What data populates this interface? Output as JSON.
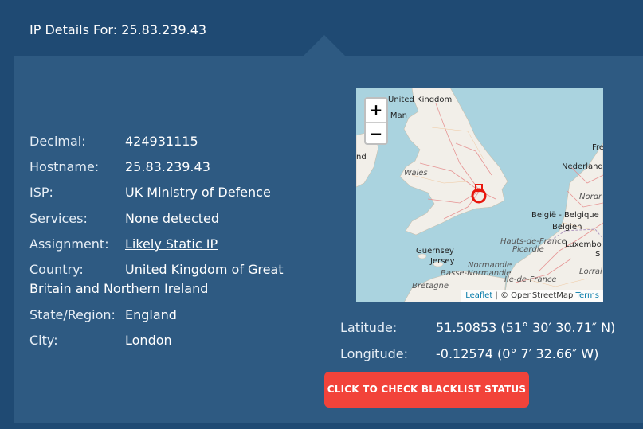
{
  "header": {
    "title": "IP Details For: 25.83.239.43"
  },
  "details": [
    {
      "label": "Decimal:",
      "value": "424931115"
    },
    {
      "label": "Hostname:",
      "value": "25.83.239.43"
    },
    {
      "label": "ISP:",
      "value": "UK Ministry of Defence"
    },
    {
      "label": "Services:",
      "value": "None detected"
    },
    {
      "label": "Assignment:",
      "value": "Likely Static IP"
    },
    {
      "label": "Country:",
      "value": "United Kingdom of Great",
      "value_cont": "Britain and Northern Ireland"
    },
    {
      "label": "State/Region:",
      "value": "England"
    },
    {
      "label": "City:",
      "value": "London"
    }
  ],
  "map": {
    "zoom_in": "+",
    "zoom_out": "−",
    "labels": {
      "uk": "United Kingdom",
      "isle_of_man": "of Man",
      "ireland_nd": "nd",
      "wales": "Wales",
      "nederland": "Nederland",
      "fre": "Fre",
      "nordr": "Nordr",
      "belgie": "België - Belgique",
      "belgien": "Belgien",
      "luxembo": "Luxembo",
      "hauts_de_france": "Hauts-de-France",
      "picardie": "Picardie",
      "guernsey": "Guernsey",
      "jersey": "Jersey",
      "normandie": "Normandie",
      "basse_normandie": "Basse-Normandie",
      "ile_de_france": "Île-de-France",
      "lorrai": "Lorrai",
      "bretagne": "Bretagne",
      "s": "S"
    },
    "attribution": {
      "leaflet": "Leaflet",
      "sep": " | © OpenStreetMap ",
      "terms": "Terms"
    },
    "marker_icon": "map-pin-icon"
  },
  "coords": {
    "latitude_label": "Latitude:",
    "latitude_value": "51.50853  (51° 30′ 30.71″ N)",
    "longitude_label": "Longitude:",
    "longitude_value": "-0.12574  (0° 7′ 32.66″ W)"
  },
  "actions": {
    "blacklist_label": "CLICK TO CHECK BLACKLIST STATUS"
  },
  "colors": {
    "background": "#1f4a73",
    "panel": "#2e5a82",
    "link": "#8fd07a",
    "button": "#f2433a"
  }
}
